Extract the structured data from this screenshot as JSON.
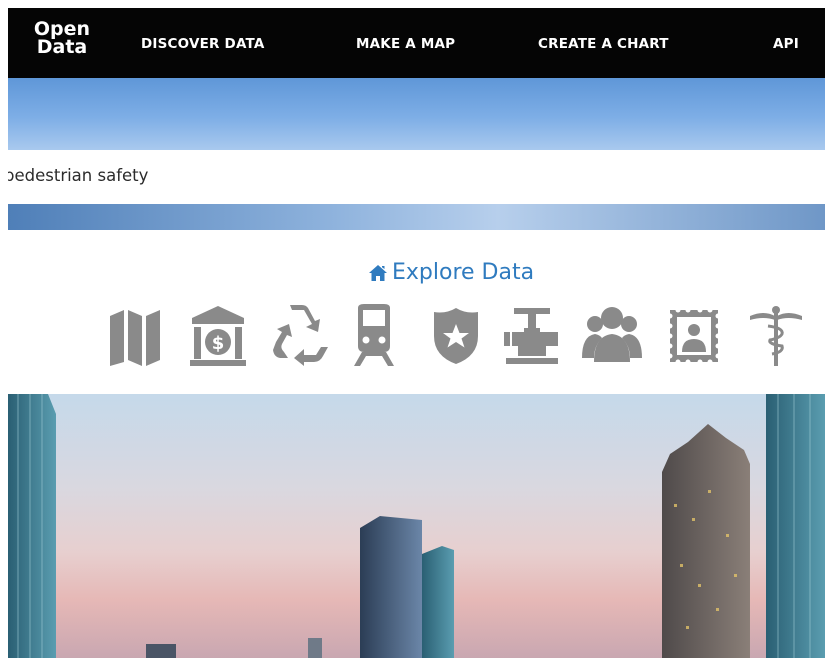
{
  "nav": {
    "logo_line1": "Open",
    "logo_line2": "Data",
    "items": [
      {
        "label": "DISCOVER DATA"
      },
      {
        "label": "MAKE A MAP"
      },
      {
        "label": "CREATE A CHART"
      },
      {
        "label": "API"
      }
    ]
  },
  "search": {
    "value": "pedestrian safety"
  },
  "explore": {
    "title": "Explore Data",
    "icon_color": "#8a8a8a",
    "title_color": "#2f7bbf",
    "categories": [
      {
        "icon": "map-icon"
      },
      {
        "icon": "bank-icon"
      },
      {
        "icon": "recycle-icon"
      },
      {
        "icon": "train-icon"
      },
      {
        "icon": "police-shield-icon"
      },
      {
        "icon": "water-valve-icon"
      },
      {
        "icon": "people-icon"
      },
      {
        "icon": "stamp-icon"
      },
      {
        "icon": "caduceus-icon"
      }
    ]
  }
}
